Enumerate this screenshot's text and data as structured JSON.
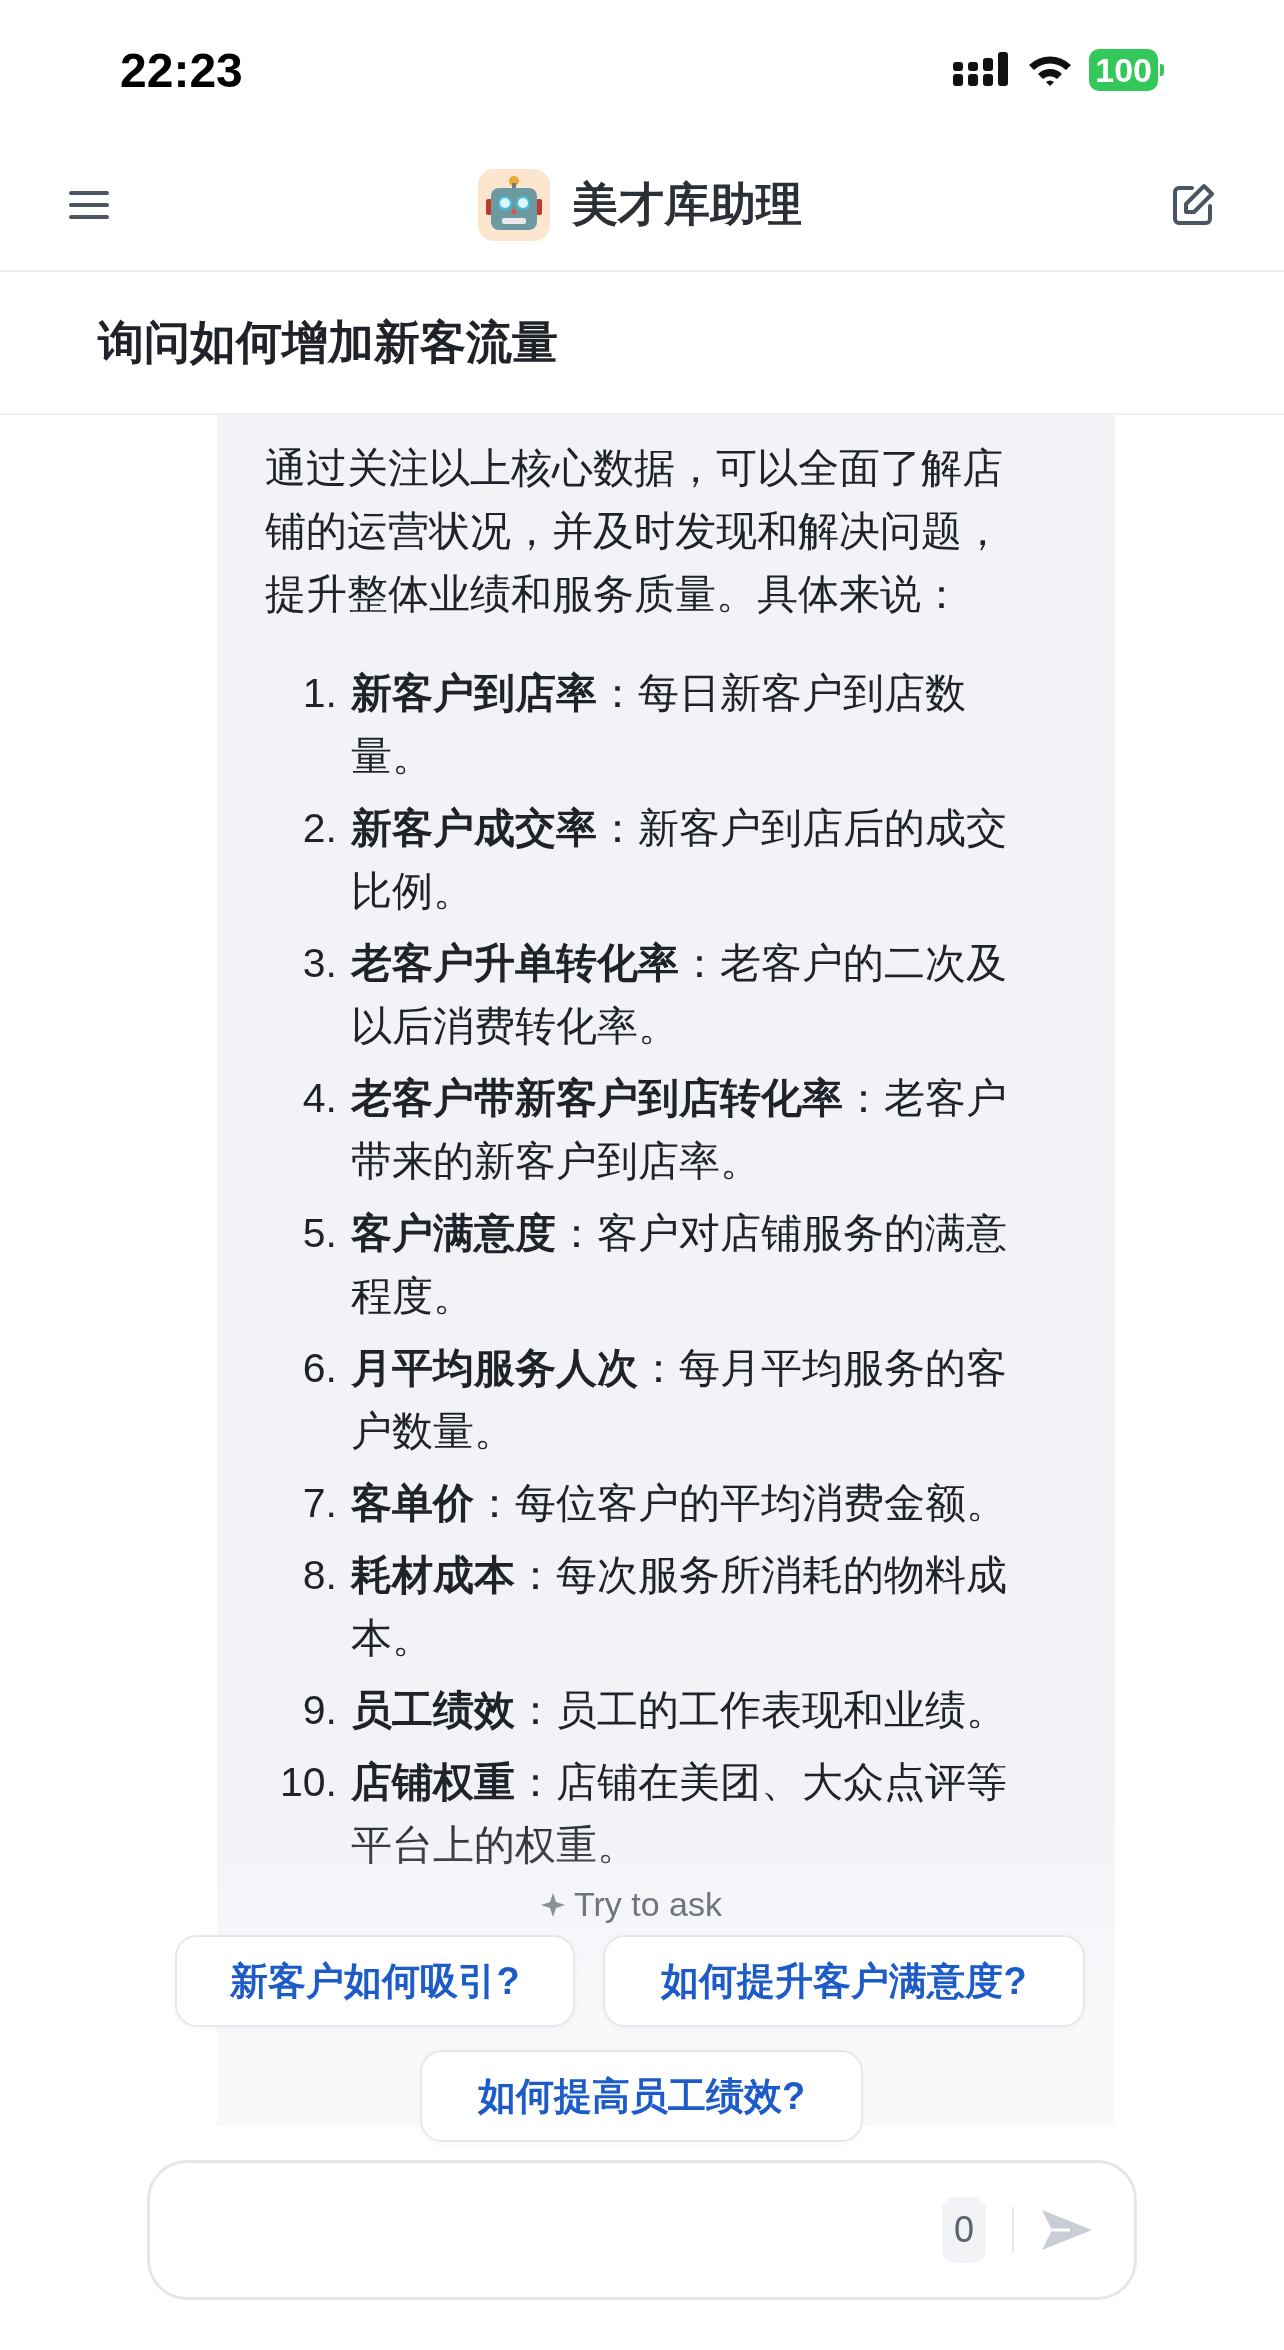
{
  "status_bar": {
    "time": "22:23",
    "battery": "100"
  },
  "header": {
    "title": "美才库助理"
  },
  "topic": {
    "title": "询问如何增加新客流量"
  },
  "message": {
    "intro": "通过关注以上核心数据，可以全面了解店铺的运营状况，并及时发现和解决问题，提升整体业绩和服务质量。具体来说：",
    "items": [
      {
        "number": "1.",
        "term": "新客户到店率",
        "text": "：每日新客户到店数量。"
      },
      {
        "number": "2.",
        "term": "新客户成交率",
        "text": "：新客户到店后的成交比例。"
      },
      {
        "number": "3.",
        "term": "老客户升单转化率",
        "text": "：老客户的二次及以后消费转化率。"
      },
      {
        "number": "4.",
        "term": "老客户带新客户到店转化率",
        "text": "：老客户带来的新客户到店率。"
      },
      {
        "number": "5.",
        "term": "客户满意度",
        "text": "：客户对店铺服务的满意程度。"
      },
      {
        "number": "6.",
        "term": "月平均服务人次",
        "text": "：每月平均服务的客户数量。"
      },
      {
        "number": "7.",
        "term": "客单价",
        "text": "：每位客户的平均消费金额。"
      },
      {
        "number": "8.",
        "term": "耗材成本",
        "text": "：每次服务所消耗的物料成本。"
      },
      {
        "number": "9.",
        "term": "员工绩效",
        "text": "：员工的工作表现和业绩。"
      },
      {
        "number": "10.",
        "term": "店铺权重",
        "text": "：店铺在美团、大众点评等平台上的权重。"
      }
    ]
  },
  "try_to_ask": {
    "label": "Try to ask"
  },
  "suggestions": [
    "新客户如何吸引?",
    "如何提升客户满意度?",
    "如何提高员工绩效?"
  ],
  "composer": {
    "count": "0"
  }
}
